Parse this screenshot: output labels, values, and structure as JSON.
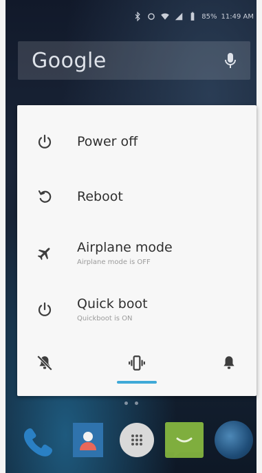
{
  "status_bar": {
    "battery": "85%",
    "time": "11:49 AM"
  },
  "search": {
    "logo_text": "Google"
  },
  "power_menu": {
    "items": [
      {
        "label": "Power off",
        "sublabel": "",
        "icon": "power-icon"
      },
      {
        "label": "Reboot",
        "sublabel": "",
        "icon": "reboot-icon"
      },
      {
        "label": "Airplane mode",
        "sublabel": "Airplane mode is OFF",
        "icon": "airplane-icon"
      },
      {
        "label": "Quick boot",
        "sublabel": "Quickboot is ON",
        "icon": "power-icon"
      }
    ],
    "sound_modes": {
      "options": [
        "silent",
        "vibrate",
        "ring"
      ],
      "selected": "vibrate"
    }
  },
  "home": {
    "page_count": 2,
    "dock_apps": [
      "phone",
      "contacts",
      "app-drawer",
      "messages",
      "browser"
    ]
  },
  "colors": {
    "accent": "#3fa9d7",
    "dialog_bg": "#f7f7f7",
    "icon": "#3d3d3d"
  }
}
